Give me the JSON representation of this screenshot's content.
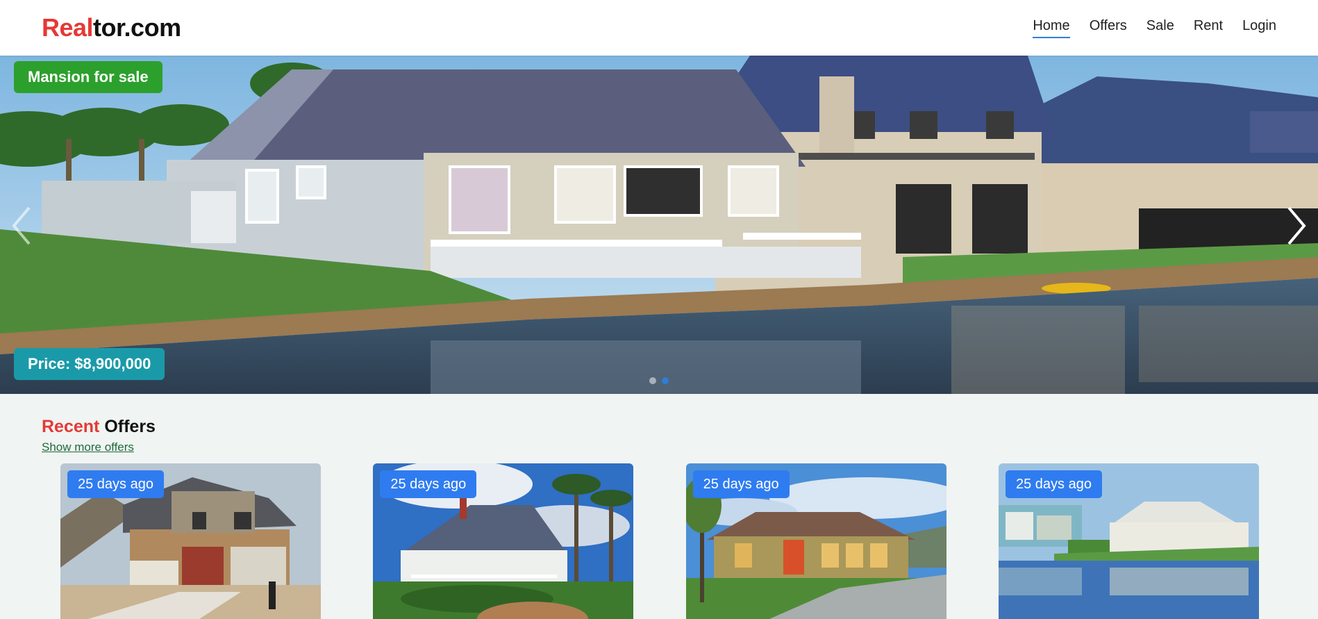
{
  "header": {
    "logo_accent": "Real",
    "logo_rest": "tor.com",
    "nav": [
      {
        "label": "Home",
        "active": true
      },
      {
        "label": "Offers"
      },
      {
        "label": "Sale"
      },
      {
        "label": "Rent"
      },
      {
        "label": "Login"
      }
    ]
  },
  "hero": {
    "type_badge": "Mansion for sale",
    "price_badge": "Price: $8,900,000",
    "prev_icon": "chevron-left-icon",
    "next_icon": "chevron-right-icon",
    "slide_count": 2,
    "active_slide": 1
  },
  "recent": {
    "title_accent": "Recent",
    "title_rest": "Offers",
    "show_more": "Show more offers",
    "cards": [
      {
        "badge": "25 days ago"
      },
      {
        "badge": "25 days ago"
      },
      {
        "badge": "25 days ago"
      },
      {
        "badge": "25 days ago"
      }
    ]
  },
  "colors": {
    "accent_red": "#e53935",
    "badge_green": "#2ca02c",
    "badge_teal": "#1a9aa8",
    "card_badge_blue": "#2f7cf0",
    "nav_underline": "#2e7dd8",
    "link_green": "#1f6b3a"
  }
}
